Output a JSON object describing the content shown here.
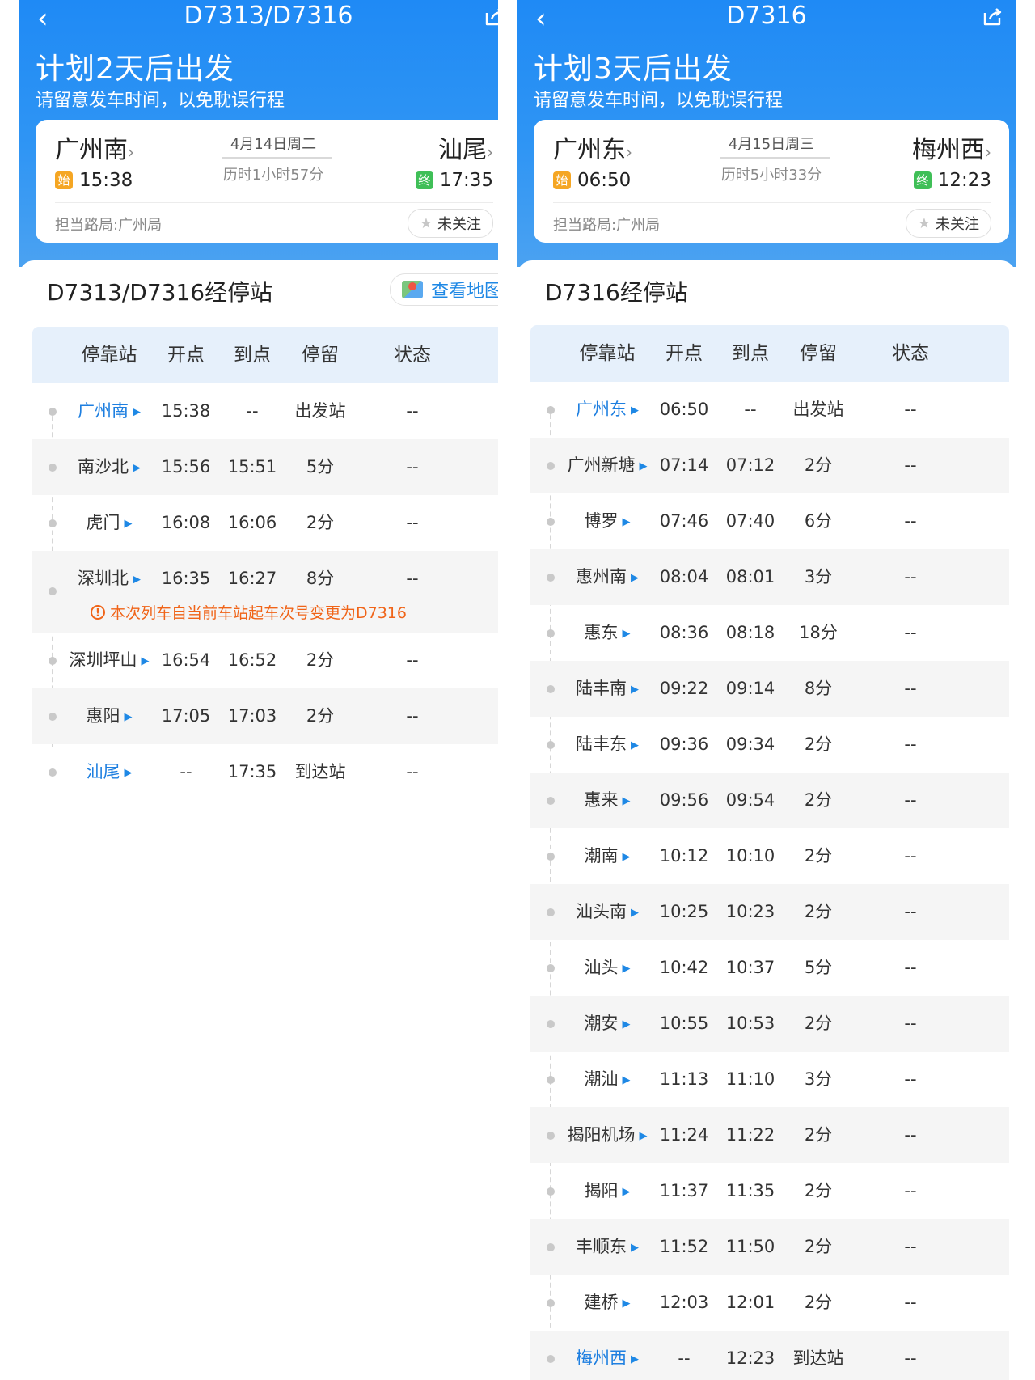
{
  "columns": [
    "停靠站",
    "开点",
    "到点",
    "停留",
    "状态"
  ],
  "left": {
    "title": "D7313/D7316",
    "headline": "计划2天后出发",
    "subline": "请留意发车时间，以免耽误行程",
    "from_station": "广州南",
    "to_station": "汕尾",
    "date": "4月14日周二",
    "duration": "历时1小时57分",
    "depart_time": "15:38",
    "arrive_time": "17:35",
    "start_tag": "始",
    "end_tag": "终",
    "bureau": "担当路局:广州局",
    "follow_label": "未关注",
    "section_title": "D7313/D7316经停站",
    "map_label": "查看地图",
    "notice": "本次列车自当前车站起车次号变更为D7316",
    "rows": [
      {
        "station": "广州南",
        "dep": "15:38",
        "arr": "--",
        "stay": "出发站",
        "status": "--",
        "blue": true
      },
      {
        "station": "南沙北",
        "dep": "15:56",
        "arr": "15:51",
        "stay": "5分",
        "status": "--",
        "blue": false
      },
      {
        "station": "虎门",
        "dep": "16:08",
        "arr": "16:06",
        "stay": "2分",
        "status": "--",
        "blue": false
      },
      {
        "station": "深圳北",
        "dep": "16:35",
        "arr": "16:27",
        "stay": "8分",
        "status": "--",
        "blue": false
      },
      {
        "station": "深圳坪山",
        "dep": "16:54",
        "arr": "16:52",
        "stay": "2分",
        "status": "--",
        "blue": false
      },
      {
        "station": "惠阳",
        "dep": "17:05",
        "arr": "17:03",
        "stay": "2分",
        "status": "--",
        "blue": false
      },
      {
        "station": "汕尾",
        "dep": "--",
        "arr": "17:35",
        "stay": "到达站",
        "status": "--",
        "blue": true
      }
    ]
  },
  "right": {
    "title": "D7316",
    "headline": "计划3天后出发",
    "subline": "请留意发车时间，以免耽误行程",
    "from_station": "广州东",
    "to_station": "梅州西",
    "date": "4月15日周三",
    "duration": "历时5小时33分",
    "depart_time": "06:50",
    "arrive_time": "12:23",
    "start_tag": "始",
    "end_tag": "终",
    "bureau": "担当路局:广州局",
    "follow_label": "未关注",
    "section_title": "D7316经停站",
    "rows": [
      {
        "station": "广州东",
        "dep": "06:50",
        "arr": "--",
        "stay": "出发站",
        "status": "--",
        "blue": true
      },
      {
        "station": "广州新塘",
        "dep": "07:14",
        "arr": "07:12",
        "stay": "2分",
        "status": "--",
        "blue": false
      },
      {
        "station": "博罗",
        "dep": "07:46",
        "arr": "07:40",
        "stay": "6分",
        "status": "--",
        "blue": false
      },
      {
        "station": "惠州南",
        "dep": "08:04",
        "arr": "08:01",
        "stay": "3分",
        "status": "--",
        "blue": false
      },
      {
        "station": "惠东",
        "dep": "08:36",
        "arr": "08:18",
        "stay": "18分",
        "status": "--",
        "blue": false
      },
      {
        "station": "陆丰南",
        "dep": "09:22",
        "arr": "09:14",
        "stay": "8分",
        "status": "--",
        "blue": false
      },
      {
        "station": "陆丰东",
        "dep": "09:36",
        "arr": "09:34",
        "stay": "2分",
        "status": "--",
        "blue": false
      },
      {
        "station": "惠来",
        "dep": "09:56",
        "arr": "09:54",
        "stay": "2分",
        "status": "--",
        "blue": false
      },
      {
        "station": "潮南",
        "dep": "10:12",
        "arr": "10:10",
        "stay": "2分",
        "status": "--",
        "blue": false
      },
      {
        "station": "汕头南",
        "dep": "10:25",
        "arr": "10:23",
        "stay": "2分",
        "status": "--",
        "blue": false
      },
      {
        "station": "汕头",
        "dep": "10:42",
        "arr": "10:37",
        "stay": "5分",
        "status": "--",
        "blue": false
      },
      {
        "station": "潮安",
        "dep": "10:55",
        "arr": "10:53",
        "stay": "2分",
        "status": "--",
        "blue": false
      },
      {
        "station": "潮汕",
        "dep": "11:13",
        "arr": "11:10",
        "stay": "3分",
        "status": "--",
        "blue": false
      },
      {
        "station": "揭阳机场",
        "dep": "11:24",
        "arr": "11:22",
        "stay": "2分",
        "status": "--",
        "blue": false
      },
      {
        "station": "揭阳",
        "dep": "11:37",
        "arr": "11:35",
        "stay": "2分",
        "status": "--",
        "blue": false
      },
      {
        "station": "丰顺东",
        "dep": "11:52",
        "arr": "11:50",
        "stay": "2分",
        "status": "--",
        "blue": false
      },
      {
        "station": "建桥",
        "dep": "12:03",
        "arr": "12:01",
        "stay": "2分",
        "status": "--",
        "blue": false
      },
      {
        "station": "梅州西",
        "dep": "--",
        "arr": "12:23",
        "stay": "到达站",
        "status": "--",
        "blue": true
      }
    ]
  }
}
